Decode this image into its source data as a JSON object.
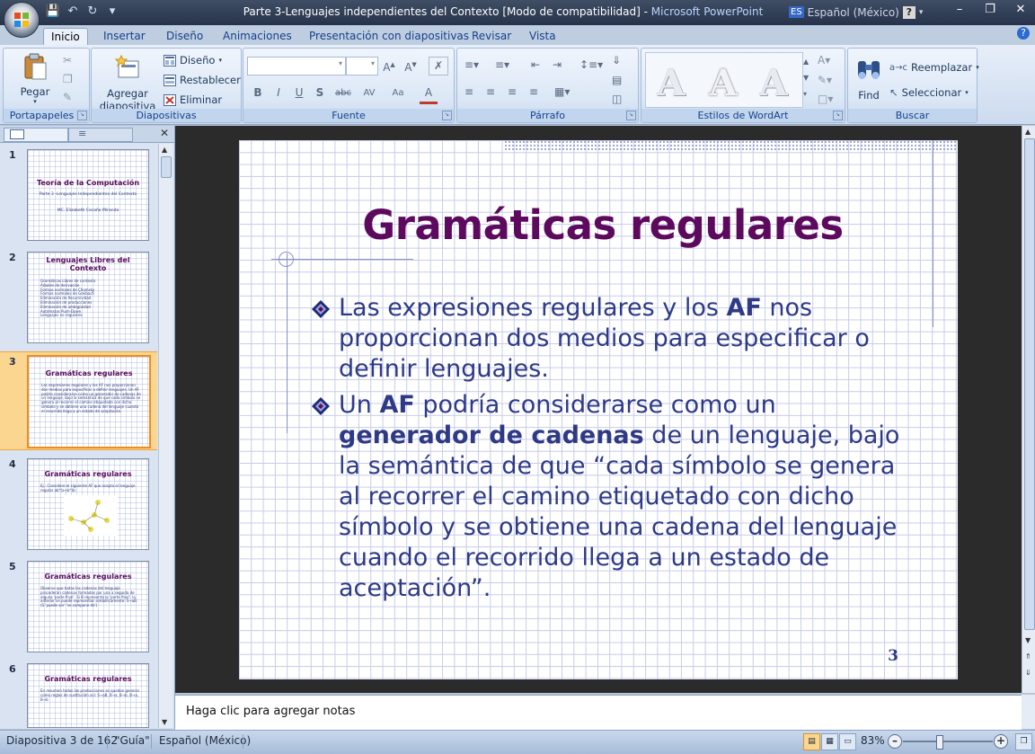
{
  "window": {
    "title": "Parte 3-Lenguajes independientes del Contexto [Modo de compatibilidad] - ",
    "app_name": "Microsoft PowerPoint",
    "language_code": "ES",
    "language_name": "Español (México)",
    "help_glyph": "?"
  },
  "ribbon": {
    "tabs": [
      "Inicio",
      "Insertar",
      "Diseño",
      "Animaciones",
      "Presentación con diapositivas",
      "Revisar",
      "Vista"
    ],
    "active_tab": "Inicio",
    "groups": {
      "portapapeles": {
        "label": "Portapapeles",
        "paste": "Pegar"
      },
      "diapositivas": {
        "label": "Diapositivas",
        "add_line1": "Agregar",
        "add_line2": "diapositiva",
        "design": "Diseño",
        "reset": "Restablecer",
        "delete": "Eliminar"
      },
      "fuente": {
        "label": "Fuente",
        "bold": "B",
        "italic": "I",
        "underline": "U",
        "strike": "abc",
        "spacing": "AV",
        "case": "Aa",
        "color": "A"
      },
      "parrafo": {
        "label": "Párrafo"
      },
      "wordart": {
        "label": "Estilos de WordArt",
        "sample": "A"
      },
      "buscar": {
        "label": "Buscar",
        "find": "Find",
        "replace": "Reemplazar",
        "select": "Seleccionar"
      }
    }
  },
  "slide_pane": {
    "thumbnails": [
      {
        "num": "1",
        "title": "Teoría de la Computación",
        "sub": "Parte 3 -Lenguajes Independientes del Contexto",
        "author": "MC. Elizabeth Cecaño Miranda"
      },
      {
        "num": "2",
        "title": "Lenguajes Libres del Contexto",
        "items": [
          "Gramáticas Libres de contexto",
          "Árboles de derivación",
          "Formas normales de Chomsky",
          "Formas normales de Greibach",
          "Eliminación de Recursividad",
          "Eliminación de producciones",
          "Eliminación de ambigüedad",
          "Autómatas Push-Down",
          "Lenguajes no regulares"
        ]
      },
      {
        "num": "3",
        "title": "Gramáticas regulares",
        "body": "Las expresiones regulares y los AF nos proporcionan dos medios para especificar o definir lenguajes. Un AF podría considerarse como un generador de cadenas de un lenguaje, bajo la semántica de que cada símbolo se genera al recorrer el camino etiquetado con dicho símbolo y se obtiene una cadena del lenguaje cuando el recorrido llega a un estado de aceptación."
      },
      {
        "num": "4",
        "title": "Gramáticas regulares",
        "body": "Ej.: Considere el siguiente AF que acepta el lenguaje regular ab*(a+b*)b:"
      },
      {
        "num": "5",
        "title": "Gramáticas regulares",
        "body": "Observe que todas las cadenas del lenguaje procederán cadenas formadas por una a seguida de alguna 'parte final'. Si B representa la 'parte final', lo anterior se puede representar simbólicamente: S→aB. (S 'puede ser' 'se compone de')"
      },
      {
        "num": "6",
        "title": "Gramáticas regulares",
        "body": "En resumen todas las producciones se quedan generar como reglas de sustitución así: S→aB, B→a, B→b, B→a, B→b"
      }
    ]
  },
  "slide": {
    "title": "Gramáticas regulares",
    "bullet1": {
      "before": "Las expresiones regulares y los ",
      "bold": "AF",
      "after": " nos proporcionan dos medios  para especificar o definir lenguajes."
    },
    "bullet2": {
      "before": "Un ",
      "bold1": "AF",
      "middle": " podría considerarse como un ",
      "bold2": "generador de cadenas",
      "after": " de un lenguaje, bajo la semántica de que “cada símbolo se genera al recorrer el camino etiquetado con dicho símbolo y se obtiene una cadena del lenguaje cuando el recorrido llega a un estado de aceptación”."
    },
    "page_number": "3"
  },
  "notes": {
    "placeholder": "Haga clic para agregar notas"
  },
  "status": {
    "slide_info": "Diapositiva 3 de 162",
    "theme": "\"Guía\"",
    "language": "Español (México)",
    "zoom": "83%",
    "zoom_fraction": 0.4
  },
  "colors": {
    "title": "#5d0a5e",
    "body": "#2e3a86",
    "accent_selected": "#f08c1c"
  }
}
